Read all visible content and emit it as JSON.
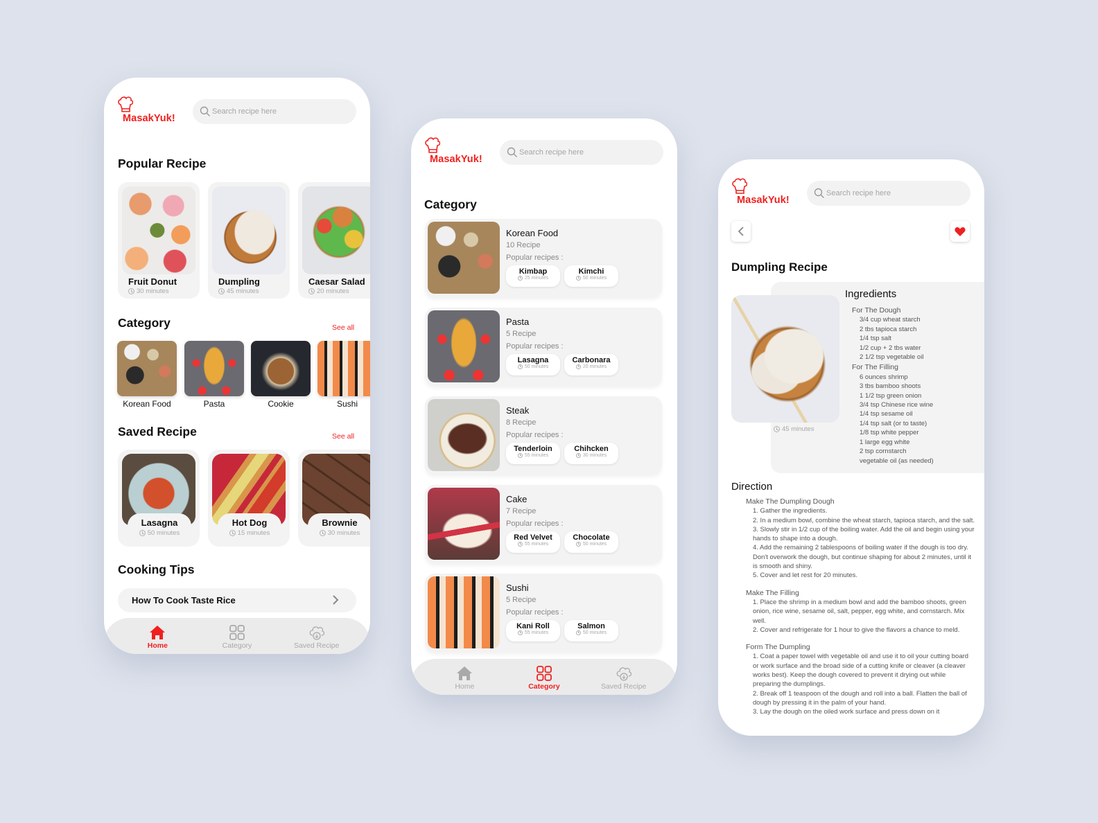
{
  "app": {
    "brand": "MasakYuk!",
    "search_placeholder": "Search recipe here",
    "accent_color": "#f0201e"
  },
  "nav": {
    "items": [
      {
        "label": "Home",
        "icon": "home-icon"
      },
      {
        "label": "Category",
        "icon": "grid-icon"
      },
      {
        "label": "Saved Recipe",
        "icon": "cloud-download-icon"
      }
    ]
  },
  "home": {
    "popular_title": "Popular Recipe",
    "popular": [
      {
        "name": "Fruit Donut",
        "time": "30 minutes"
      },
      {
        "name": "Dumpling",
        "time": "45 minutes"
      },
      {
        "name": "Caesar Salad",
        "time": "20 minutes"
      }
    ],
    "category_title": "Category",
    "see_all": "See all",
    "categories": [
      "Korean Food",
      "Pasta",
      "Cookie",
      "Sushi"
    ],
    "saved_title": "Saved Recipe",
    "saved": [
      {
        "name": "Lasagna",
        "time": "50 minutes"
      },
      {
        "name": "Hot Dog",
        "time": "15 minutes"
      },
      {
        "name": "Brownie",
        "time": "30 minutes"
      }
    ],
    "tips_title": "Cooking Tips",
    "tip": "How To Cook Taste Rice",
    "active_nav": "Home"
  },
  "category_page": {
    "title": "Category",
    "popular_label": "Popular recipes :",
    "active_nav": "Category",
    "rows": [
      {
        "name": "Korean Food",
        "count": "10 Recipe",
        "recipes": [
          {
            "name": "Kimbap",
            "time": "25 minutes"
          },
          {
            "name": "Kimchi",
            "time": "50 minutes"
          }
        ]
      },
      {
        "name": "Pasta",
        "count": "5 Recipe",
        "recipes": [
          {
            "name": "Lasagna",
            "time": "50 minutes"
          },
          {
            "name": "Carbonara",
            "time": "20 minutes"
          }
        ]
      },
      {
        "name": "Steak",
        "count": "8 Recipe",
        "recipes": [
          {
            "name": "Tenderloin",
            "time": "55 minutes"
          },
          {
            "name": "Chihcken",
            "time": "30 minutes"
          }
        ]
      },
      {
        "name": "Cake",
        "count": "7 Recipe",
        "recipes": [
          {
            "name": "Red Velvet",
            "time": "55 minutes"
          },
          {
            "name": "Chocolate",
            "time": "50 minutes"
          }
        ]
      },
      {
        "name": "Sushi",
        "count": "5 Recipe",
        "recipes": [
          {
            "name": "Kani Roll",
            "time": "55 minutes"
          },
          {
            "name": "Salmon",
            "time": "50 minutes"
          }
        ]
      }
    ]
  },
  "detail": {
    "title": "Dumpling Recipe",
    "time": "45 minutes",
    "favorited": true,
    "ingredients_title": "Ingredients",
    "ingredients": [
      {
        "group": "For The Dough",
        "items": [
          "3/4 cup wheat starch",
          "2 tbs tapioca starch",
          "1/4 tsp salt",
          "1/2 cup + 2 tbs water",
          "2 1/2 tsp vegetable oil"
        ]
      },
      {
        "group": "For The Filling",
        "items": [
          "6 ounces shrimp",
          "3 tbs bamboo shoots",
          "1 1/2 tsp green onion",
          "3/4 tsp Chinese rice wine",
          "1/4 tsp sesame oil",
          "1/4 tsp salt (or to taste)",
          "1/8 tsp white pepper",
          "1 large egg white",
          "2 tsp cornstarch",
          "vegetable oil (as needed)"
        ]
      }
    ],
    "direction_title": "Direction",
    "directions": [
      {
        "group": "Make The Dumpling Dough",
        "steps": [
          "1. Gather the ingredients.",
          "2. In a medium bowl, combine the wheat starch, tapioca starch, and the salt.",
          "3. Slowly stir in 1/2 cup of the boiling water. Add the oil and begin using your hands to shape into a dough.",
          "4. Add the remaining 2 tablespoons of boiling water if the dough is too dry. Don't overwork the dough, but continue shaping for about 2 minutes, until it is smooth and shiny.",
          "5. Cover and let rest for 20 minutes."
        ]
      },
      {
        "group": "Make The Filling",
        "steps": [
          "1. Place the shrimp in a medium bowl and add the bamboo shoots, green onion, rice wine, sesame oil, salt, pepper, egg white, and cornstarch. Mix well.",
          "2. Cover and refrigerate for 1 hour to give the flavors a chance to meld."
        ]
      },
      {
        "group": "Form The Dumpling",
        "steps": [
          "1. Coat a paper towel with vegetable oil and use it to oil your cutting board or work surface and the broad side of a cutting knife or cleaver (a cleaver works best). Keep the dough covered to prevent it drying out while preparing the dumplings.",
          "2. Break off 1 teaspoon of the dough and roll into a ball. Flatten the ball of dough by pressing it in the palm of your hand.",
          "3. Lay the dough on the oiled work surface and press down on it"
        ]
      }
    ]
  }
}
